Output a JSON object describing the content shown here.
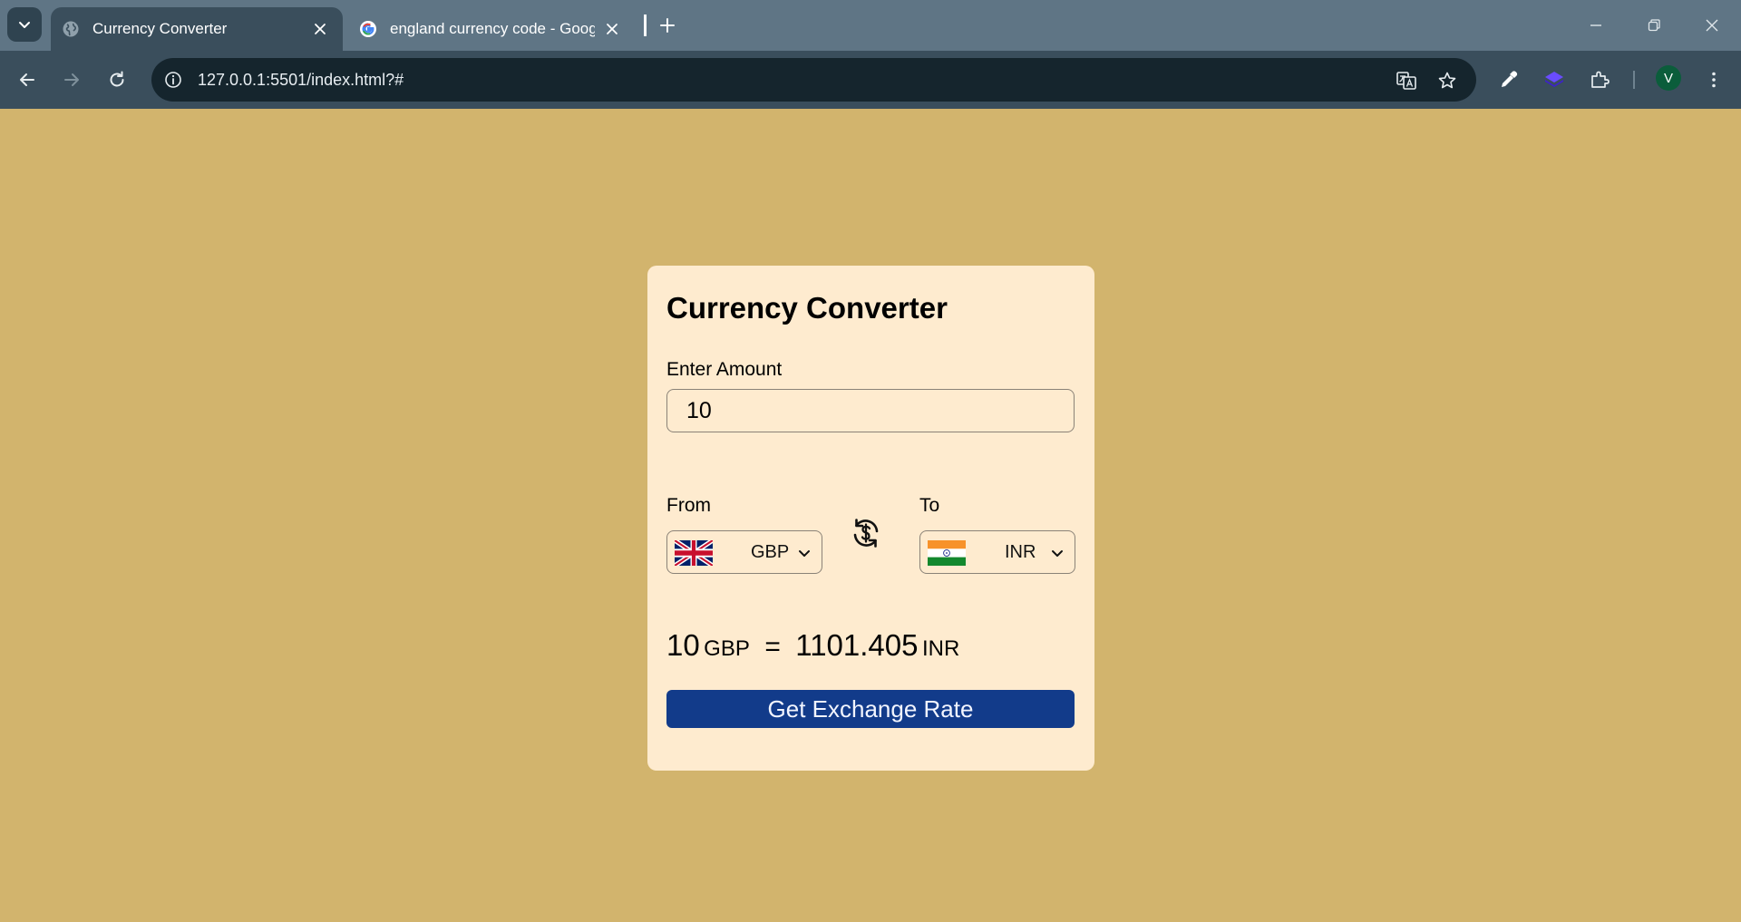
{
  "browser": {
    "tabs": [
      {
        "title": "Currency Converter",
        "active": true,
        "favicon": "globe-icon"
      },
      {
        "title": "england currency code - Googl",
        "active": false,
        "favicon": "google-icon"
      }
    ],
    "address_bar": {
      "url": "127.0.0.1:5501/index.html?#"
    },
    "profile_initial": "V"
  },
  "app": {
    "title": "Currency Converter",
    "amount_label": "Enter Amount",
    "amount_value": "10",
    "from_label": "From",
    "to_label": "To",
    "from_currency": "GBP",
    "to_currency": "INR",
    "result": {
      "amount": "10",
      "from_code": "GBP",
      "equals": "=",
      "converted": "1101.405",
      "to_code": "INR"
    },
    "button_label": "Get Exchange Rate"
  },
  "colors": {
    "page_background": "#d2b46d",
    "card_background": "#feebcf",
    "button_background": "#123b8a",
    "tabstrip": "#5f7585",
    "toolbar": "#3a4e5c"
  }
}
